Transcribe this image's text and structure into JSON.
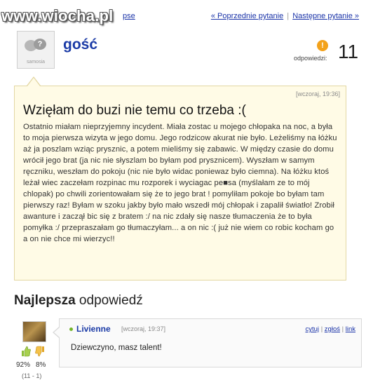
{
  "watermark": "www.wiocha.pl",
  "top": {
    "left_link": "pse",
    "prev_question": "« Poprzednie pytanie",
    "separator": "|",
    "next_question": "Następne pytanie »"
  },
  "question": {
    "author": "gość",
    "avatar_caption": "samosia",
    "answers_icon": "!",
    "answers_label": "odpowiedzi:",
    "answers_count": "11",
    "time": "[wczoraj, 19:36]",
    "title": "Wzięłam do buzi nie temu co trzeba :(",
    "body": "Ostatnio miałam nieprzyjemny incydent. Miała zostac u mojego chłopaka na noc, a była to moja pierwsza wizyta w jego domu. Jego rodzicow akurat nie było. Leżeliśmy na łóżku aż ja poszlam wziąc prysznic, a potem mieliśmy się zabawic. W między czasie do domu wrócił jego brat (ja nic nie słyszlam bo byłam pod prysznicem). Wyszłam w samym ręczniku, weszłam do pokoju (nic nie było widac poniewaz było ciemna). Na łóżku ktoś leżał wiec zaczełam rozpinac mu rozporek i wyciagac pe■sa (myślałam ze to mój chlopak) po chwili zorientowałam się że to jego brat ! pomyliłam pokoje bo byłam tam pierwszy raz! Byłam w szoku jakby było mało wszedł mój chłopak i zapalił światło! Zrobił awanture i zaczął bic się z bratem :/ na nic zdały się nasze tłumaczenia że to była pomyłka :/ przepraszałam go tłumaczyłam... a on nic :( już nie wiem co robic kocham go a on nie chce mi wierzyc!!"
  },
  "best_answer": {
    "heading_bold": "Najlepsza",
    "heading_rest": " odpowiedź",
    "user": "Livienne",
    "time": "[wczoraj, 19:37]",
    "actions": [
      "cytuj",
      "zgłoś",
      "link"
    ],
    "action_sep": "|",
    "text": "Dziewczyno, masz talent!",
    "vote_up_pct": "92%",
    "vote_down_pct": "8%",
    "vote_totals": "(11 - 1)"
  },
  "colors": {
    "link": "#1a33a8",
    "question_bg": "#fffbe6",
    "answers_badge": "#f3a21b",
    "online_dot": "#73b52a"
  },
  "icons": [
    "question-mark-icon",
    "thumbs-up-icon",
    "thumbs-down-icon"
  ]
}
